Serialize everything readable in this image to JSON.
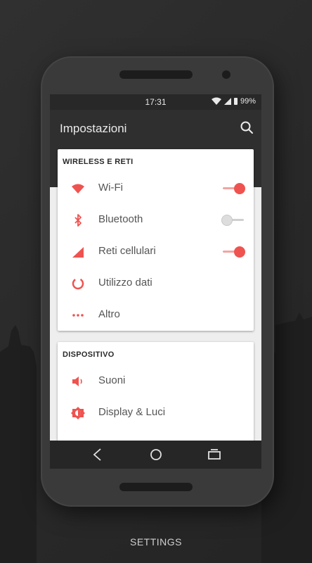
{
  "status_bar": {
    "time": "17:31",
    "battery": "99%"
  },
  "app_bar": {
    "title": "Impostazioni",
    "search_icon": "search-icon"
  },
  "accent_color": "#ef5350",
  "sections": [
    {
      "header": "WIRELESS E RETI",
      "items": [
        {
          "label": "Wi-Fi",
          "icon": "wifi-icon",
          "toggle": "on"
        },
        {
          "label": "Bluetooth",
          "icon": "bluetooth-icon",
          "toggle": "off"
        },
        {
          "label": "Reti cellulari",
          "icon": "cellular-icon",
          "toggle": "on"
        },
        {
          "label": "Utilizzo dati",
          "icon": "data-usage-icon"
        },
        {
          "label": "Altro",
          "icon": "more-icon"
        }
      ]
    },
    {
      "header": "DISPOSITIVO",
      "items": [
        {
          "label": "Suoni",
          "icon": "volume-icon"
        },
        {
          "label": "Display & Luci",
          "icon": "brightness-icon"
        }
      ]
    }
  ],
  "nav_bar": {
    "back": "back-icon",
    "home": "home-icon",
    "recents": "recents-icon"
  },
  "footer": {
    "caption": "SETTINGS"
  }
}
